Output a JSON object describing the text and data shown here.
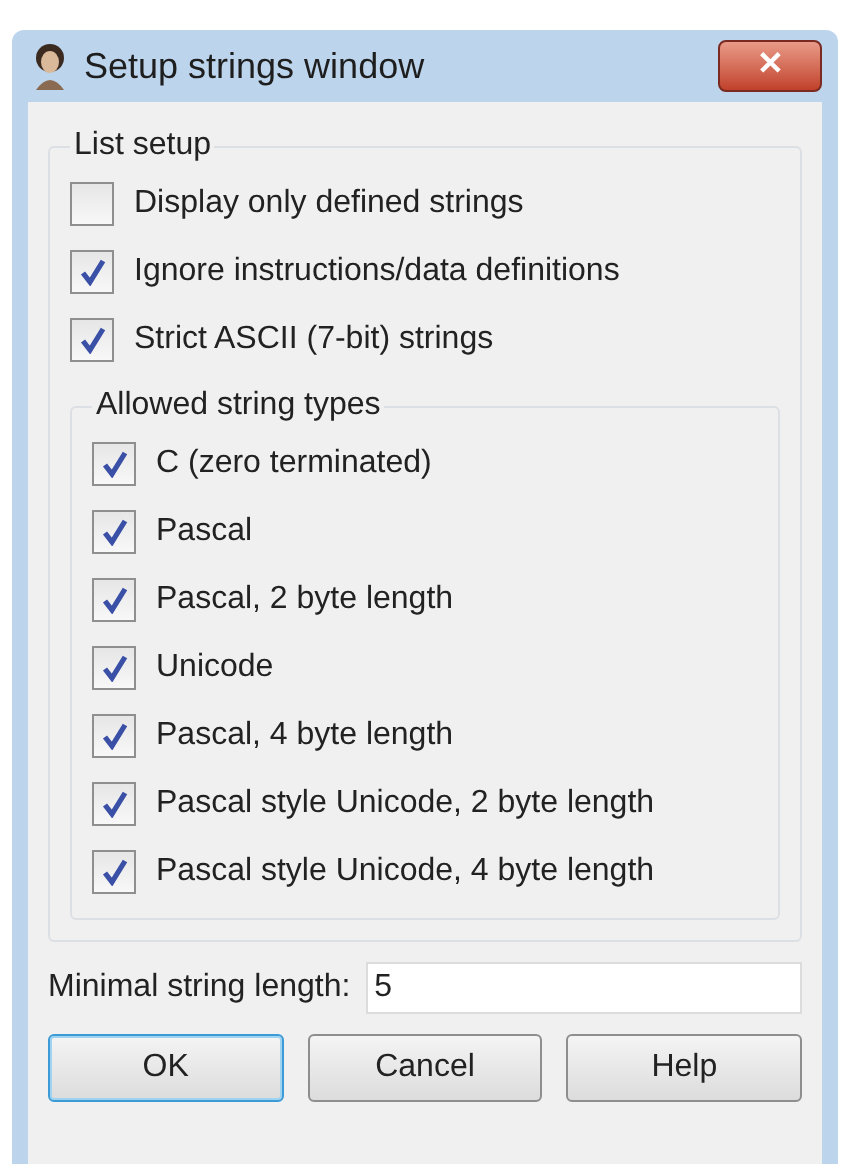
{
  "window": {
    "title": "Setup strings window",
    "close_label": "✕"
  },
  "list_setup": {
    "title": "List setup",
    "options": [
      {
        "label": "Display only defined strings",
        "checked": false
      },
      {
        "label": "Ignore instructions/data definitions",
        "checked": true
      },
      {
        "label": "Strict ASCII (7-bit) strings",
        "checked": true
      }
    ],
    "allowed_types": {
      "title": "Allowed string types",
      "options": [
        {
          "label": "C (zero terminated)",
          "checked": true
        },
        {
          "label": "Pascal",
          "checked": true
        },
        {
          "label": "Pascal, 2 byte length",
          "checked": true
        },
        {
          "label": "Unicode",
          "checked": true
        },
        {
          "label": "Pascal, 4 byte length",
          "checked": true
        },
        {
          "label": "Pascal style Unicode, 2 byte length",
          "checked": true
        },
        {
          "label": "Pascal style Unicode, 4 byte length",
          "checked": true
        }
      ]
    }
  },
  "min_length": {
    "label": "Minimal string length:",
    "value": "5"
  },
  "buttons": [
    {
      "label": "OK",
      "selected": true
    },
    {
      "label": "Cancel",
      "selected": false
    },
    {
      "label": "Help",
      "selected": false
    }
  ]
}
